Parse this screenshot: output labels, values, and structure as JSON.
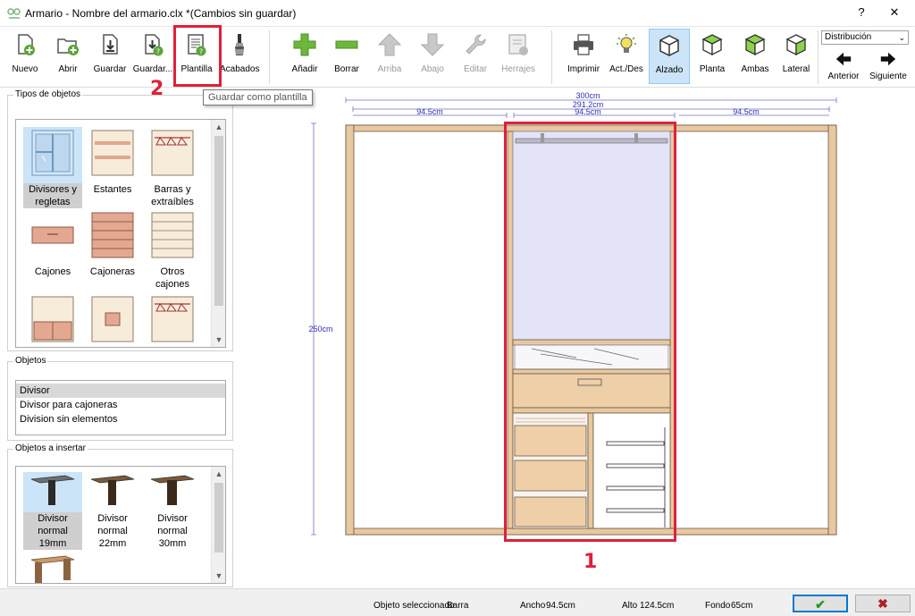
{
  "window": {
    "title": "Armario - Nombre del armario.clx *(Cambios sin guardar)",
    "help_label": "?",
    "close_label": "✕"
  },
  "toolbar": {
    "nuevo": "Nuevo",
    "abrir": "Abrir",
    "guardar": "Guardar",
    "guardar_como": "Guardar...",
    "plantilla": "Plantilla",
    "acabados": "Acabados",
    "anadir": "Añadir",
    "borrar": "Borrar",
    "arriba": "Arriba",
    "abajo": "Abajo",
    "editar": "Editar",
    "herrajes": "Herrajes",
    "imprimir": "Imprimir",
    "act_des": "Act./Des",
    "alzado": "Alzado",
    "planta": "Planta",
    "ambas": "Ambas",
    "lateral": "Lateral",
    "distribucion": "Distribución",
    "anterior": "Anterior",
    "siguiente": "Siguiente"
  },
  "tooltip": "Guardar como plantilla",
  "panels": {
    "tipos_title": "Tipos de objetos",
    "tipos": [
      {
        "line1": "Divisores y",
        "line2": "regletas"
      },
      {
        "line1": "Estantes",
        "line2": ""
      },
      {
        "line1": "Barras y",
        "line2": "extraíbles"
      },
      {
        "line1": "Cajones",
        "line2": ""
      },
      {
        "line1": "Cajoneras",
        "line2": ""
      },
      {
        "line1": "Otros",
        "line2": "cajones"
      }
    ],
    "objetos_title": "Objetos",
    "objetos": [
      "Divisor",
      "Divisor para cajoneras",
      "Division sin elementos"
    ],
    "insertar_title": "Objetos a insertar",
    "insertar": [
      {
        "line1": "Divisor",
        "line2": "normal",
        "line3": "19mm"
      },
      {
        "line1": "Divisor",
        "line2": "normal",
        "line3": "22mm"
      },
      {
        "line1": "Divisor",
        "line2": "normal",
        "line3": "30mm"
      }
    ]
  },
  "dimensions": {
    "total": "300cm",
    "inner": "291.2cm",
    "left": "94.5cm",
    "center": "94.5cm",
    "right": "94.5cm",
    "height": "250cm"
  },
  "status": {
    "selected_label": "Objeto seleccionado",
    "selected_value": "Barra",
    "width_label": "Ancho",
    "width_value": "94.5cm",
    "height_label": "Alto",
    "height_value": "124.5cm",
    "depth_label": "Fondo",
    "depth_value": "65cm",
    "ok": "✔",
    "cancel": "✖"
  },
  "annotations": {
    "one": "1",
    "two": "2"
  },
  "colors": {
    "accent": "#0078d7",
    "annotation": "#e0203a",
    "wood": "#e8c8a0",
    "panel_fill": "#e4e4f7"
  }
}
